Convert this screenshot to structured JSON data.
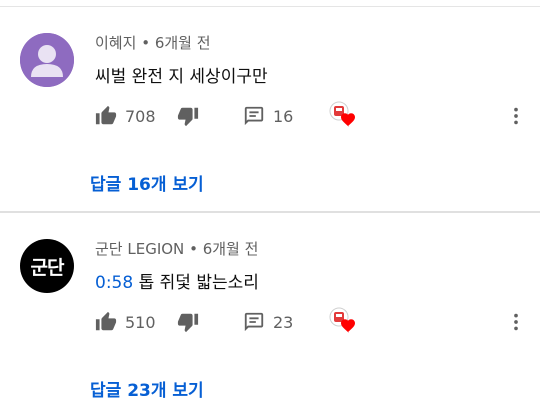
{
  "comments": [
    {
      "author": "이혜지",
      "separator": "•",
      "time": "6개월 전",
      "timestamp_link": "",
      "text": "씨벌 완전 지 세상이구만",
      "likes": "708",
      "replies": "16",
      "replies_link": "답글 16개 보기",
      "avatar_color": "#8e6bc0"
    },
    {
      "author": "군단 LEGION",
      "separator": "•",
      "time": "6개월 전",
      "timestamp_link": "0:58",
      "text": "톱 쥐덫 밟는소리",
      "likes": "510",
      "replies": "23",
      "replies_link": "답글 23개 보기",
      "avatar_text": "군단",
      "avatar_color": "#000000"
    }
  ],
  "colors": {
    "link": "#065fd4",
    "meta": "#606060",
    "heart": "#ff0000"
  },
  "icons": {
    "like": "thumbs-up-icon",
    "dislike": "thumbs-down-icon",
    "reply": "reply-icon",
    "creator_heart": "heart-badge-icon",
    "more": "more-vertical-icon"
  }
}
